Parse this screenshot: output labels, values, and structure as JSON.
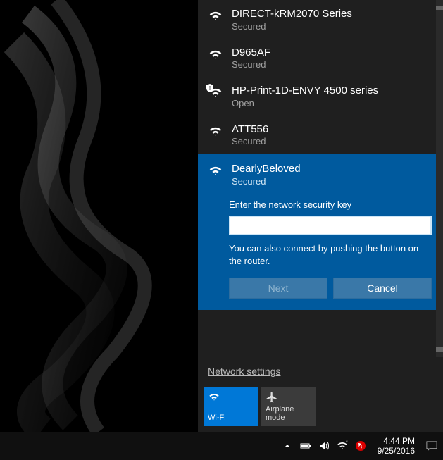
{
  "networks": [
    {
      "name": "DIRECT-kRM2070 Series",
      "status": "Secured",
      "secured": true,
      "shield": false
    },
    {
      "name": "D965AF",
      "status": "Secured",
      "secured": true,
      "shield": false
    },
    {
      "name": "HP-Print-1D-ENVY 4500 series",
      "status": "Open",
      "secured": false,
      "shield": true
    },
    {
      "name": "ATT556",
      "status": "Secured",
      "secured": true,
      "shield": false
    }
  ],
  "selected": {
    "name": "DearlyBeloved",
    "status": "Secured",
    "prompt": "Enter the network security key",
    "input_value": "",
    "hint": "You can also connect by pushing the button on the router.",
    "next_label": "Next",
    "cancel_label": "Cancel"
  },
  "settings_link": "Network settings",
  "tiles": {
    "wifi": "Wi-Fi",
    "airplane": "Airplane mode"
  },
  "clock": {
    "time": "4:44 PM",
    "date": "9/25/2016"
  }
}
